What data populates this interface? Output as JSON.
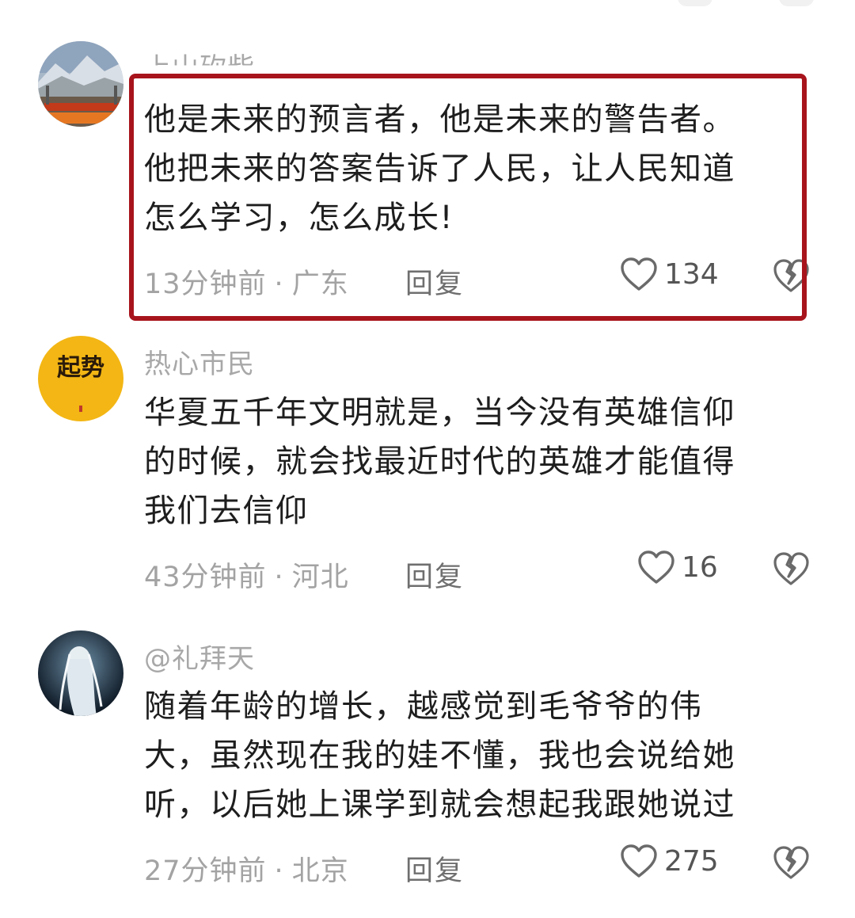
{
  "comments": [
    {
      "username": "上山砍柴",
      "content_lines": [
        "他是未来的预言者，他是未来的警告者。",
        "他把未来的答案告诉了人民，让人民知道",
        "怎么学习，怎么成长!"
      ],
      "time": "13分钟前",
      "separator": "·",
      "location": "广东",
      "reply_label": "回复",
      "likes": "134",
      "highlighted": true
    },
    {
      "username": "热心市民",
      "avatar_text": "起势",
      "content_lines": [
        "华夏五千年文明就是，当今没有英雄信仰",
        "的时候，就会找最近时代的英雄才能值得",
        "我们去信仰"
      ],
      "time": "43分钟前",
      "separator": "·",
      "location": "河北",
      "reply_label": "回复",
      "likes": "16"
    },
    {
      "username": "@礼拜天",
      "content_lines": [
        "随着年龄的增长，越感觉到毛爷爷的伟",
        "大，虽然现在我的娃不懂，我也会说给她",
        "听，以后她上课学到就会想起我跟她说过"
      ],
      "time": "27分钟前",
      "separator": "·",
      "location": "北京",
      "reply_label": "回复",
      "likes": "275"
    }
  ],
  "icons": {
    "like": "heart-outline-icon",
    "dislike": "broken-heart-icon"
  },
  "colors": {
    "highlight_border": "#a8141c",
    "meta_text": "#a3a3a3",
    "content_text": "#1e1e1e"
  }
}
